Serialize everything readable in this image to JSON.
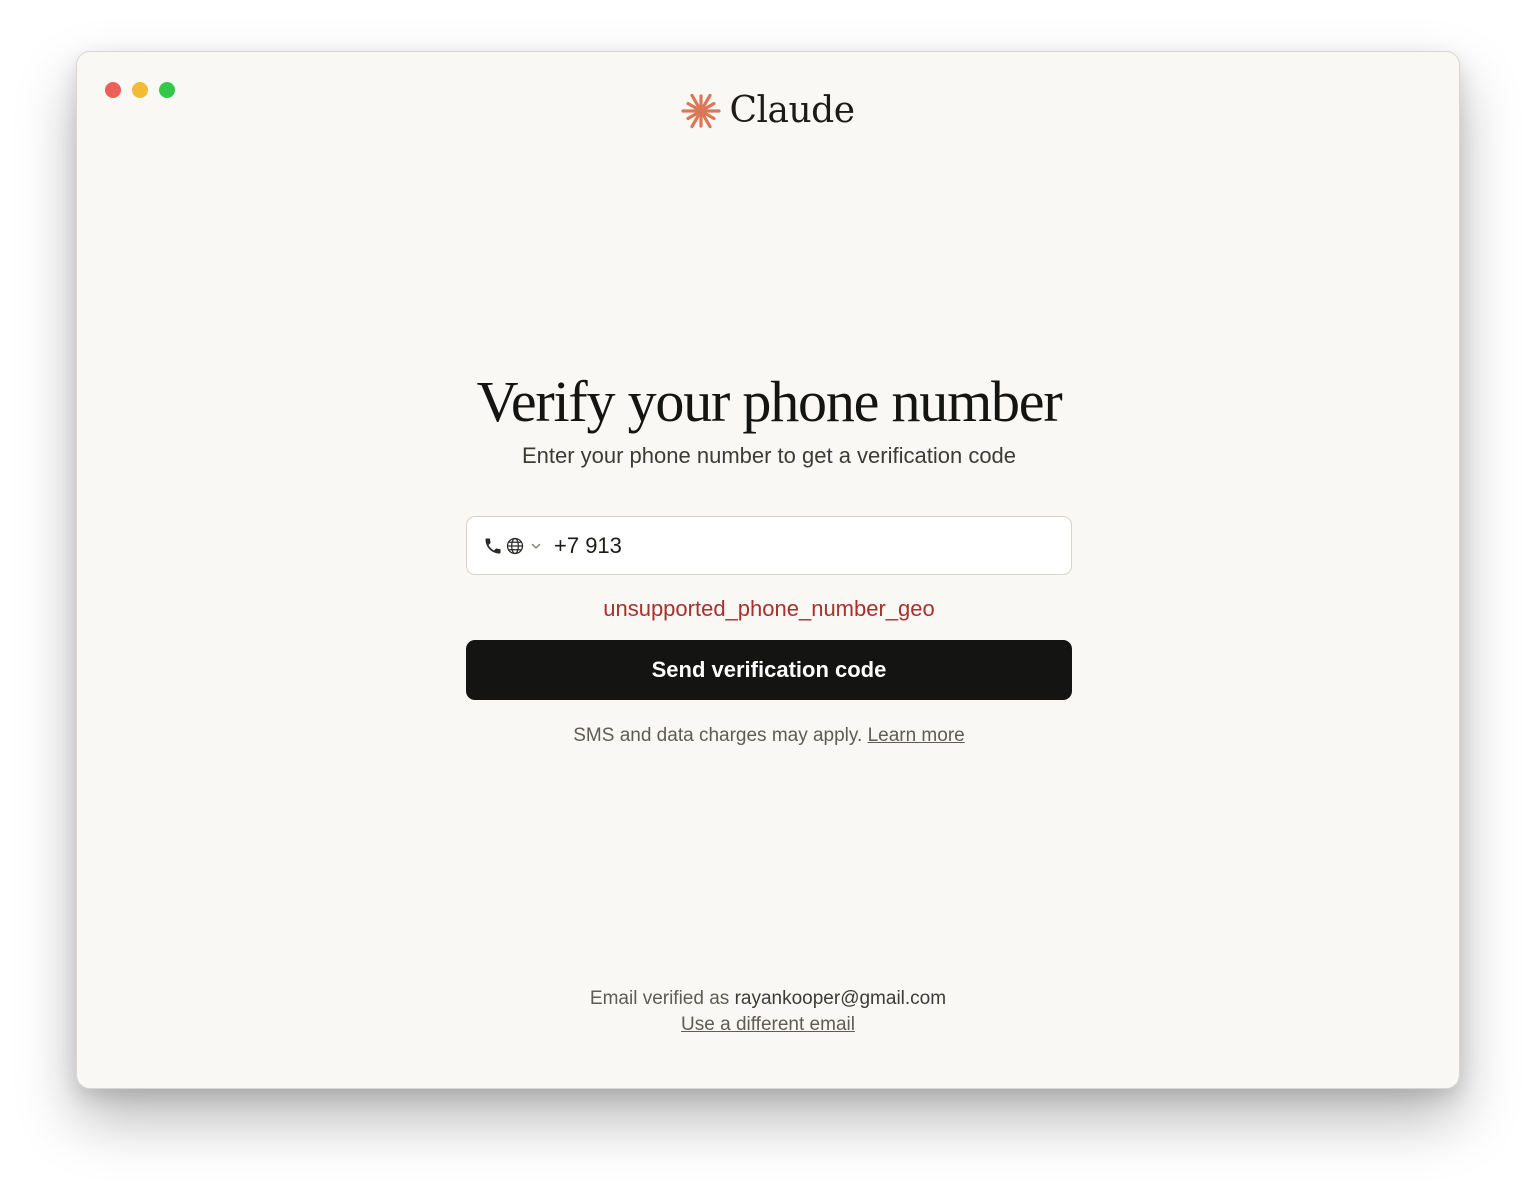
{
  "window": {
    "controls": [
      "close",
      "minimize",
      "zoom"
    ]
  },
  "brand": {
    "name": "Claude",
    "icon": "asterisk-burst-icon",
    "accent_color": "#d97757"
  },
  "main": {
    "title": "Verify your phone number",
    "subtitle": "Enter your phone number to get a verification code",
    "phone": {
      "country_icons": [
        "phone-icon",
        "globe-icon",
        "chevron-down-icon"
      ],
      "value": "+7 913"
    },
    "error": "unsupported_phone_number_geo",
    "error_color": "#a8302e",
    "submit_label": "Send verification code",
    "disclaimer_text": "SMS and data charges may apply.",
    "learn_more_label": "Learn more"
  },
  "footer": {
    "verified_prefix": "Email verified as",
    "email": "rayankooper@gmail.com",
    "change_email_label": "Use a different email"
  }
}
